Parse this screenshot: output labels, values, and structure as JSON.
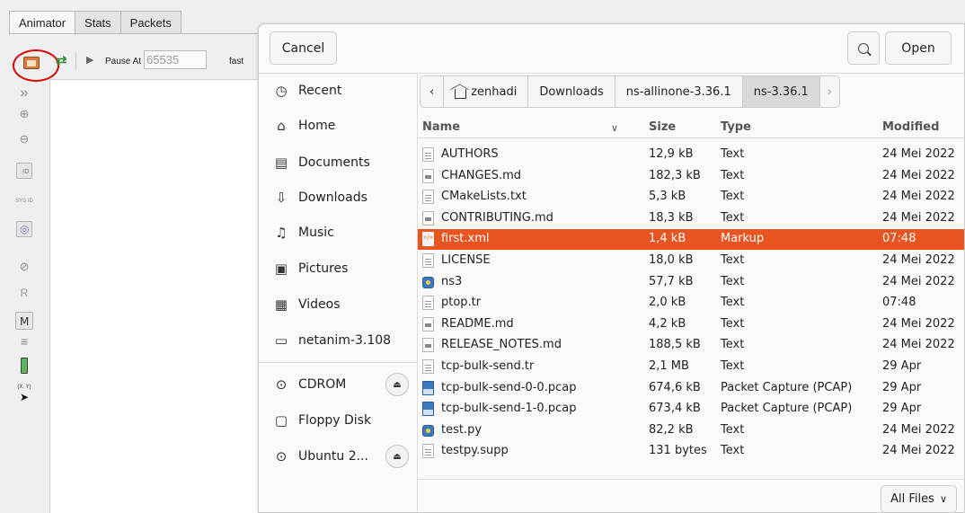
{
  "animator": {
    "tabs": [
      "Animator",
      "Stats",
      "Packets"
    ],
    "toolbar": {
      "pause_at_label": "Pause At",
      "pause_at_value": "65535",
      "speed_label": "fast"
    },
    "sidebar_labels": {
      "node_id": "ID",
      "sysid": "SYS ID",
      "r": "R",
      "m": "M",
      "xy": "(X, Y)"
    }
  },
  "dialog": {
    "cancel_label": "Cancel",
    "open_label": "Open",
    "places": [
      {
        "label": "Recent",
        "icon": "clock-icon"
      },
      {
        "label": "Home",
        "icon": "home-icon"
      },
      {
        "label": "Documents",
        "icon": "document-icon"
      },
      {
        "label": "Downloads",
        "icon": "download-icon"
      },
      {
        "label": "Music",
        "icon": "music-icon"
      },
      {
        "label": "Pictures",
        "icon": "picture-icon"
      },
      {
        "label": "Videos",
        "icon": "film-icon"
      },
      {
        "label": "netanim-3.108",
        "icon": "folder-icon"
      },
      {
        "label": "CDROM",
        "icon": "disc-icon"
      },
      {
        "label": "Floppy Disk",
        "icon": "drive-icon"
      },
      {
        "label": "Ubuntu 2...",
        "icon": "disc-icon"
      }
    ],
    "path": [
      "zenhadi",
      "Downloads",
      "ns-allinone-3.36.1",
      "ns-3.36.1"
    ],
    "columns": {
      "name": "Name",
      "size": "Size",
      "type": "Type",
      "modified": "Modified"
    },
    "files": [
      {
        "name": "AUTHORS",
        "size": "12,9 kB",
        "type": "Text",
        "modified": "24 Mei 2022",
        "kind": "txt"
      },
      {
        "name": "CHANGES.md",
        "size": "182,3 kB",
        "type": "Text",
        "modified": "24 Mei 2022",
        "kind": "md"
      },
      {
        "name": "CMakeLists.txt",
        "size": "5,3 kB",
        "type": "Text",
        "modified": "24 Mei 2022",
        "kind": "txt"
      },
      {
        "name": "CONTRIBUTING.md",
        "size": "18,3 kB",
        "type": "Text",
        "modified": "24 Mei 2022",
        "kind": "md"
      },
      {
        "name": "first.xml",
        "size": "1,4 kB",
        "type": "Markup",
        "modified": "07:48",
        "kind": "xml",
        "selected": true
      },
      {
        "name": "LICENSE",
        "size": "18,0 kB",
        "type": "Text",
        "modified": "24 Mei 2022",
        "kind": "txt"
      },
      {
        "name": "ns3",
        "size": "57,7 kB",
        "type": "Text",
        "modified": "24 Mei 2022",
        "kind": "py"
      },
      {
        "name": "ptop.tr",
        "size": "2,0 kB",
        "type": "Text",
        "modified": "07:48",
        "kind": "txt"
      },
      {
        "name": "README.md",
        "size": "4,2 kB",
        "type": "Text",
        "modified": "24 Mei 2022",
        "kind": "md"
      },
      {
        "name": "RELEASE_NOTES.md",
        "size": "188,5 kB",
        "type": "Text",
        "modified": "24 Mei 2022",
        "kind": "md"
      },
      {
        "name": "tcp-bulk-send.tr",
        "size": "2,1 MB",
        "type": "Text",
        "modified": "29 Apr",
        "kind": "txt"
      },
      {
        "name": "tcp-bulk-send-0-0.pcap",
        "size": "674,6 kB",
        "type": "Packet Capture (PCAP)",
        "modified": "29 Apr",
        "kind": "pcap"
      },
      {
        "name": "tcp-bulk-send-1-0.pcap",
        "size": "673,4 kB",
        "type": "Packet Capture (PCAP)",
        "modified": "29 Apr",
        "kind": "pcap"
      },
      {
        "name": "test.py",
        "size": "82,2 kB",
        "type": "Text",
        "modified": "24 Mei 2022",
        "kind": "py"
      },
      {
        "name": "testpy.supp",
        "size": "131 bytes",
        "type": "Text",
        "modified": "24 Mei 2022",
        "kind": "txt"
      }
    ],
    "filter_label": "All Files",
    "accent_color": "#e95420"
  }
}
